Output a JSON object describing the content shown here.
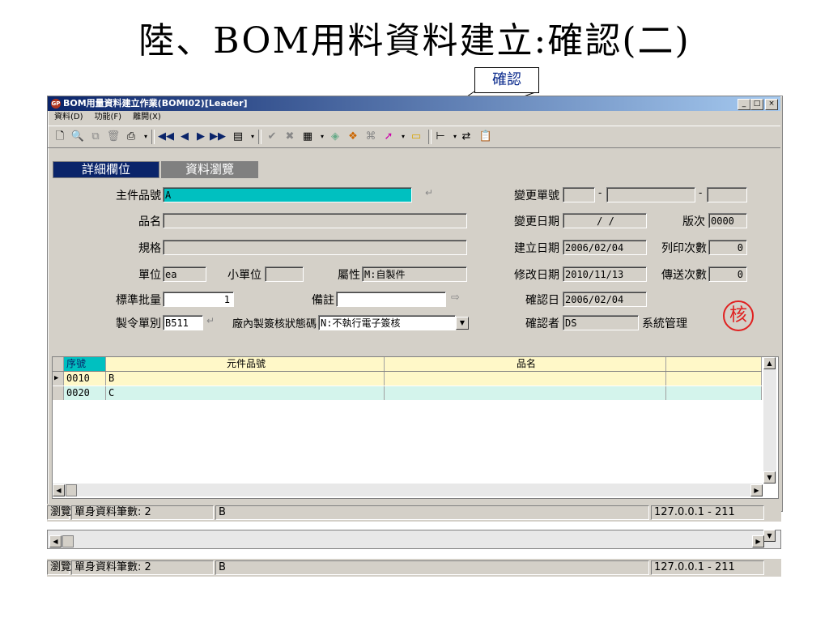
{
  "slide": {
    "title": "陸、BOM用料資料建立:確認(二)",
    "callout": "確認"
  },
  "window": {
    "title": "BOM用量資料建立作業(BOMI02)[Leader]",
    "app_badge": "GP",
    "menu": [
      "資料(D)",
      "功能(F)",
      "離開(X)"
    ],
    "controls": {
      "minimize": "_",
      "maximize": "□",
      "close": "×"
    }
  },
  "tabs": [
    "詳細欄位",
    "資料瀏覽"
  ],
  "form": {
    "main_part_label": "主件品號",
    "main_part_value": "A",
    "name_label": "品名",
    "name_value": "",
    "spec_label": "規格",
    "spec_value": "",
    "unit_label": "單位",
    "unit_value": "ea",
    "small_unit_label": "小單位",
    "small_unit_value": "",
    "attr_label": "屬性",
    "attr_value": "M:自製件",
    "batch_label": "標準批量",
    "batch_value": "1",
    "remark_label": "備註",
    "remark_value": "",
    "order_label": "製令單別",
    "order_value": "B511",
    "sign_label": "廠內製簽核狀態碼",
    "sign_value": "N:不執行電子簽核",
    "change_no_label": "變更單號",
    "change_no_sep": "-",
    "change_date_label": "變更日期",
    "change_date_value": "/ /",
    "version_label": "版次",
    "version_value": "0000",
    "created_label": "建立日期",
    "created_value": "2006/02/04",
    "print_count_label": "列印次數",
    "print_count_value": "0",
    "modified_label": "修改日期",
    "modified_value": "2010/11/13",
    "send_count_label": "傳送次數",
    "send_count_value": "0",
    "confirm_date_label": "確認日",
    "confirm_date_value": "2006/02/04",
    "confirmer_label": "確認者",
    "confirmer_value": "DS",
    "confirmer_name": "系統管理",
    "stamp": "核"
  },
  "grid": {
    "headers": [
      "序號",
      "元件品號",
      "品名"
    ],
    "rows": [
      {
        "seq": "0010",
        "part": "B",
        "name": ""
      },
      {
        "seq": "0020",
        "part": "C",
        "name": ""
      }
    ]
  },
  "status1": {
    "mode": "瀏覽",
    "count": "單身資料筆數: 2",
    "current": "B",
    "host": "127.0.0.1 - 211"
  },
  "status2": {
    "mode": "瀏覽",
    "count": "單身資料筆數: 2",
    "current": "B",
    "host": "127.0.0.1 - 211"
  },
  "colors": {
    "accent_field": "#00c0c0",
    "title_bar": "#0a246a",
    "row_alt": "#d4f4ec",
    "tab_active": "#0a246a"
  }
}
